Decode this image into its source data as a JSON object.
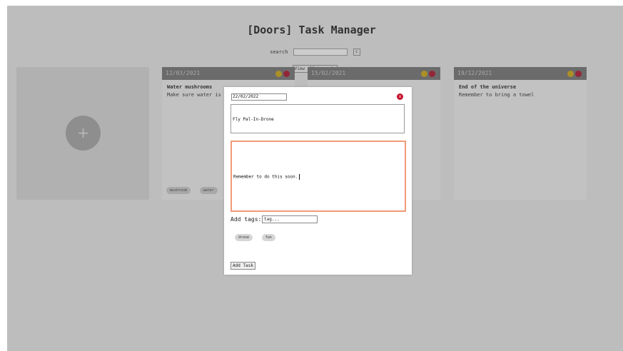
{
  "app_title": "[Doors] Task Manager",
  "search": {
    "label": "search",
    "value": "",
    "clear_label": "c"
  },
  "view_tags_label": "View all tags |v",
  "add_card": {
    "icon": "+"
  },
  "cards": [
    {
      "date": "12/03/2021",
      "title": "Water mushrooms",
      "body": "Make sure water is",
      "tags": [
        "mushroom",
        "water",
        "f"
      ]
    },
    {
      "date": "15/02/2021",
      "title": "",
      "body": "",
      "tags": []
    },
    {
      "date": "19/12/2021",
      "title": "End of the universe",
      "body": "Remember to bring a towel",
      "tags": []
    }
  ],
  "modal": {
    "date_value": "22/02/2022",
    "close_icon": "x",
    "title_value": "Fly Pal-In-Drone",
    "description_value": "Remember to do this soon.",
    "tags_label": "Add tags:",
    "tag_placeholder": "tag...",
    "tags": [
      "drone",
      "fun"
    ],
    "submit_label": "Add Task"
  },
  "colors": {
    "card_header": "#6b6b6b",
    "dot_yellow": "#cca300",
    "dot_red": "#a8001c",
    "focus_border": "#f29a7a",
    "close_button": "#c8102e"
  }
}
